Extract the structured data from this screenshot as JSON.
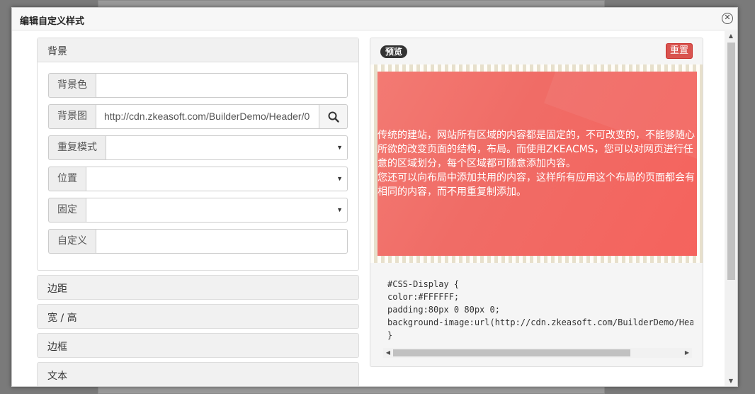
{
  "dialog": {
    "title": "编辑自定义样式",
    "close_icon": "close-icon"
  },
  "background_section": {
    "header": "背景",
    "fields": [
      {
        "label": "背景色",
        "value": ""
      },
      {
        "label": "背景图",
        "value": "http://cdn.zkeasoft.com/BuilderDemo/Header/0"
      },
      {
        "label": "重复模式",
        "value": ""
      },
      {
        "label": "位置",
        "value": ""
      },
      {
        "label": "固定",
        "value": ""
      },
      {
        "label": "自定义",
        "value": ""
      }
    ]
  },
  "collapsed_sections": [
    "边距",
    "宽 / 高",
    "边框",
    "文本"
  ],
  "preview": {
    "badge": "预览",
    "reset_label": "重置",
    "display_text": [
      "传统的建站，网站所有区域的内容都是固定的，不可改变的，不能够随心",
      "所欲的改变页面的结构，布局。而使用ZKEACMS，您可以对网页进行任",
      "意的区域划分，每个区域都可随意添加内容。",
      "您还可以向布局中添加共用的内容，这样所有应用这个布局的页面都会有",
      "相同的内容，而不用重复制添加。"
    ],
    "code_lines": [
      "#CSS-Display {",
      "color:#FFFFFF;",
      "padding:80px 0 80px 0;",
      "background-image:url(http://cdn.zkeasoft.com/BuilderDemo/Header/",
      "}"
    ]
  },
  "colors": {
    "reset_button": "#d9534f",
    "preview_bg": "#f06c66",
    "display_text": "#FFFFFF"
  }
}
